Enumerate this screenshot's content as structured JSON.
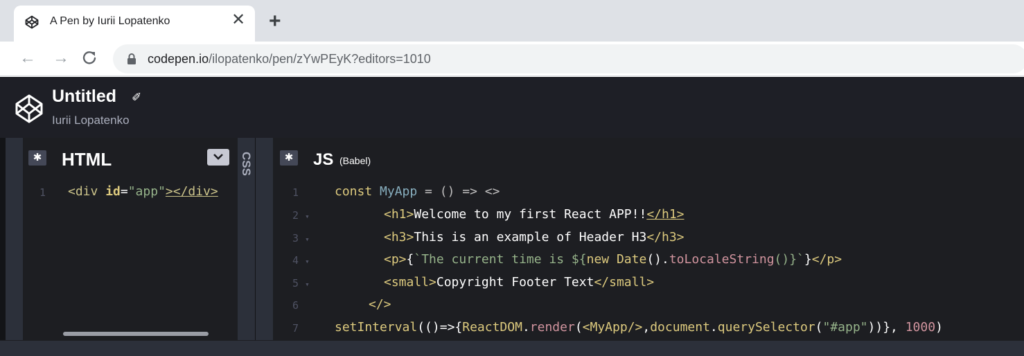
{
  "browser": {
    "tab_title": "A Pen by Iurii Lopatenko",
    "tab_close": "✕",
    "new_tab": "+",
    "back": "←",
    "forward": "→",
    "reload": "C",
    "url_host": "codepen.io",
    "url_path": "/ilopatenko/pen/zYwPEyK?editors=1010"
  },
  "codepen": {
    "title": "Untitled",
    "pencil": "✐",
    "author": "Iurii Lopatenko"
  },
  "html_editor": {
    "label": "HTML",
    "gear": "✱",
    "line_numbers": [
      "1"
    ],
    "code": {
      "l1_open": "<div ",
      "l1_attr": "id",
      "l1_eq": "=",
      "l1_val": "\"app\"",
      "l1_close": "></div>"
    }
  },
  "css_editor": {
    "label": "CSS"
  },
  "js_editor": {
    "label": "JS",
    "sublabel": "(Babel)",
    "gear": "✱",
    "line_numbers": [
      "1",
      "2",
      "3",
      "4",
      "5",
      "6",
      "7"
    ],
    "fold_marker": "▾",
    "code": {
      "l1_kw": "const",
      "l1_var": "MyApp",
      "l1_rest": " = () => <>",
      "l2_open": "<h1>",
      "l2_text": "Welcome to my first React APP!!",
      "l2_close": "</h1>",
      "l3_open": "<h3>",
      "l3_text": "This is an example of Header H3",
      "l3_close": "</h3>",
      "l4_open": "<p>",
      "l4_brace": "{",
      "l4_tpl": "`The current time is ${",
      "l4_new": "new",
      "l4_date": " Date",
      "l4_paren": "().",
      "l4_fn": "toLocaleString",
      "l4_tail": "()}`",
      "l4_brace2": "}",
      "l4_close": "</p>",
      "l5_open": "<small>",
      "l5_text": "Copyright Footer Text",
      "l5_close": "</small>",
      "l6": "</>",
      "l7_fn": "setInterval",
      "l7_a": "(()=>{",
      "l7_obj": "ReactDOM",
      "l7_dot": ".",
      "l7_render": "render",
      "l7_b": "(",
      "l7_jsx": "<MyApp/>",
      "l7_c": ",",
      "l7_doc": "document",
      "l7_dot2": ".",
      "l7_qs": "querySelector",
      "l7_d": "(",
      "l7_str": "\"#app\"",
      "l7_e": "))}, ",
      "l7_num": "1000",
      "l7_f": ")"
    }
  },
  "colors": {
    "header_bg": "#1e1f26",
    "editor_bg": "#1d1e22",
    "chrome_bg": "#dee1e6"
  }
}
